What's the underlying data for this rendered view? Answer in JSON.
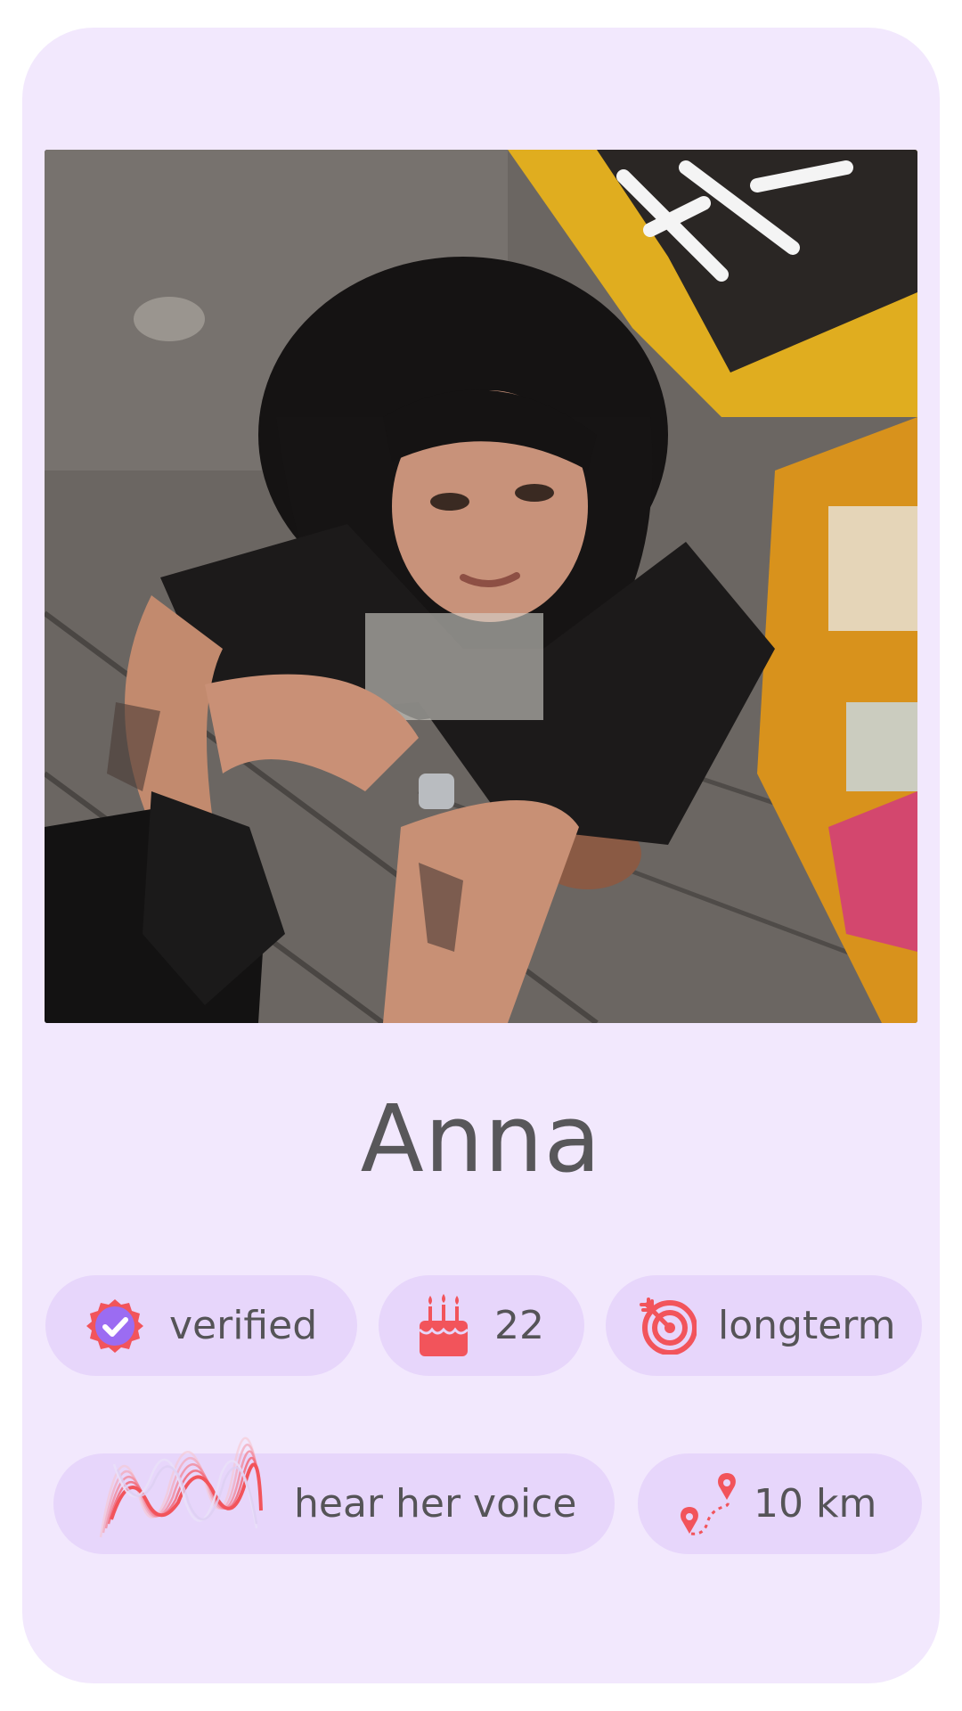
{
  "profile": {
    "name": "Anna",
    "photo_alt": "profile-photo"
  },
  "tags": {
    "verified": {
      "label": "verified",
      "icon": "verified-badge-icon"
    },
    "age": {
      "label": "22",
      "icon": "birthday-cake-icon"
    },
    "goal": {
      "label": "longterm",
      "icon": "target-icon"
    },
    "voice": {
      "label": "hear her voice",
      "icon": "sound-wave-icon"
    },
    "distance": {
      "label": "10 km",
      "icon": "location-route-icon"
    }
  },
  "colors": {
    "card_bg": "#f2e8fd",
    "pill_bg": "#e7d6fb",
    "accent_red": "#f2545b",
    "badge_purple": "#9b6cf2",
    "text": "#555457"
  }
}
